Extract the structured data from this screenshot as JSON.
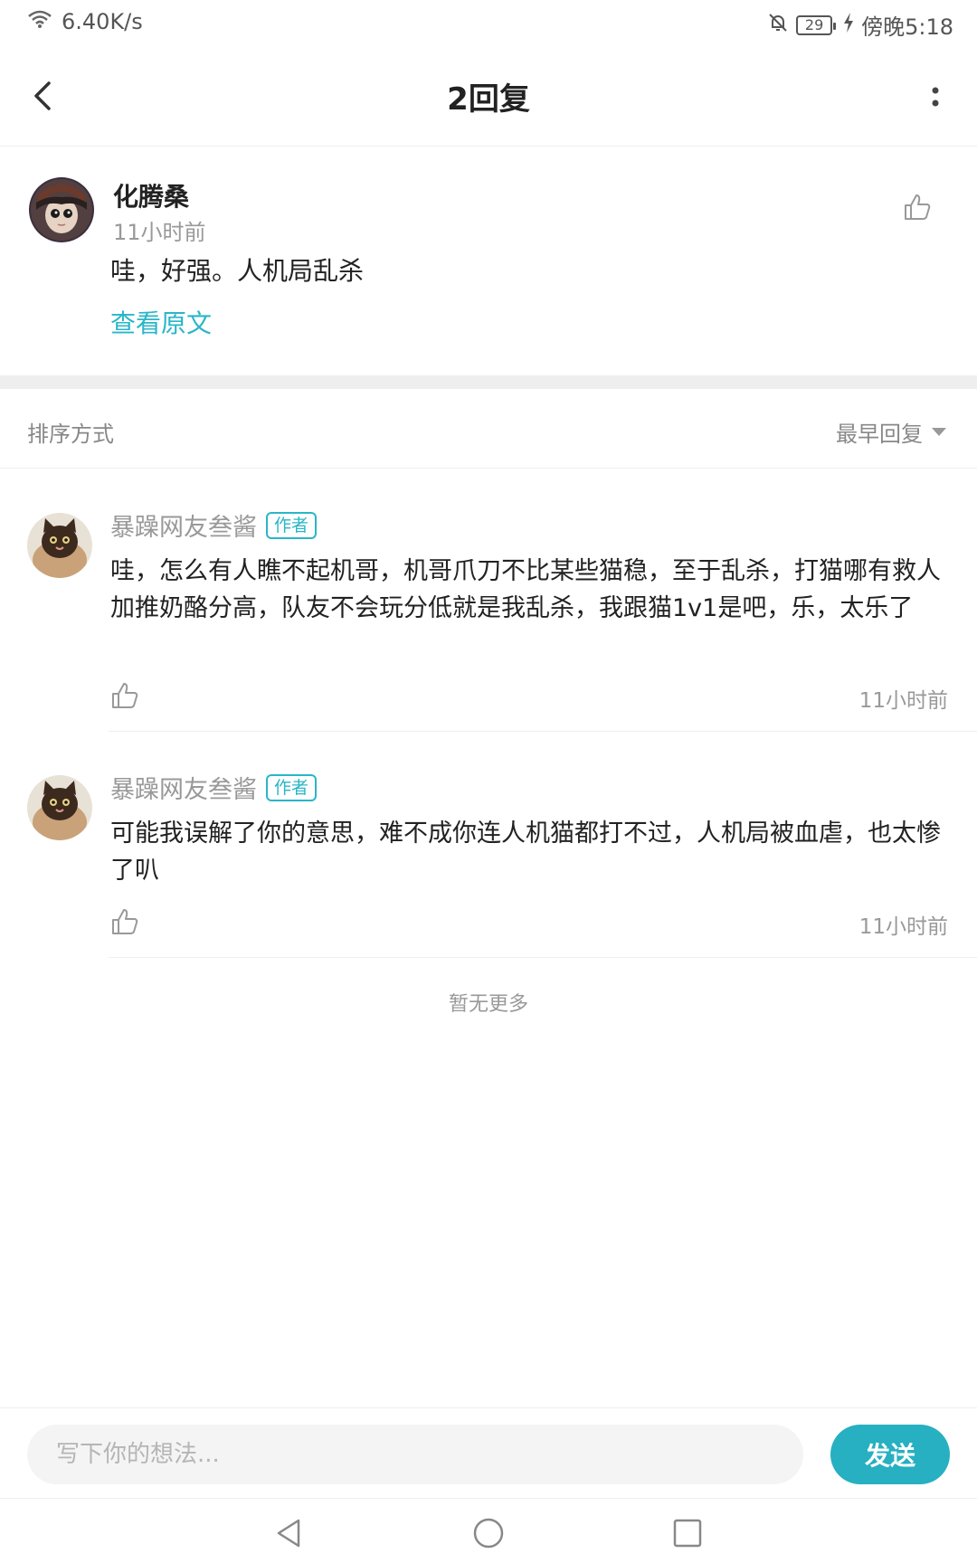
{
  "status_bar": {
    "network_speed": "6.40K/s",
    "battery": "29",
    "time": "傍晚5:18"
  },
  "header": {
    "title": "2回复"
  },
  "post": {
    "author": "化腾桑",
    "time": "11小时前",
    "text": "哇，好强。人机局乱杀",
    "view_original": "查看原文"
  },
  "sort": {
    "label": "排序方式",
    "selected": "最早回复"
  },
  "replies": [
    {
      "author": "暴躁网友叁酱",
      "badge": "作者",
      "text": "哇，怎么有人瞧不起机哥，机哥爪刀不比某些猫稳，至于乱杀，打猫哪有救人加推奶酪分高，队友不会玩分低就是我乱杀，我跟猫1v1是吧，乐，太乐了",
      "time": "11小时前"
    },
    {
      "author": "暴躁网友叁酱",
      "badge": "作者",
      "text": "可能我误解了你的意思，难不成你连人机猫都打不过，人机局被血虐，也太惨了叭",
      "time": "11小时前"
    }
  ],
  "no_more": "暂无更多",
  "input": {
    "placeholder": "写下你的想法..."
  },
  "send_label": "发送",
  "colors": {
    "accent": "#26b0c1",
    "link": "#29b6c8"
  }
}
